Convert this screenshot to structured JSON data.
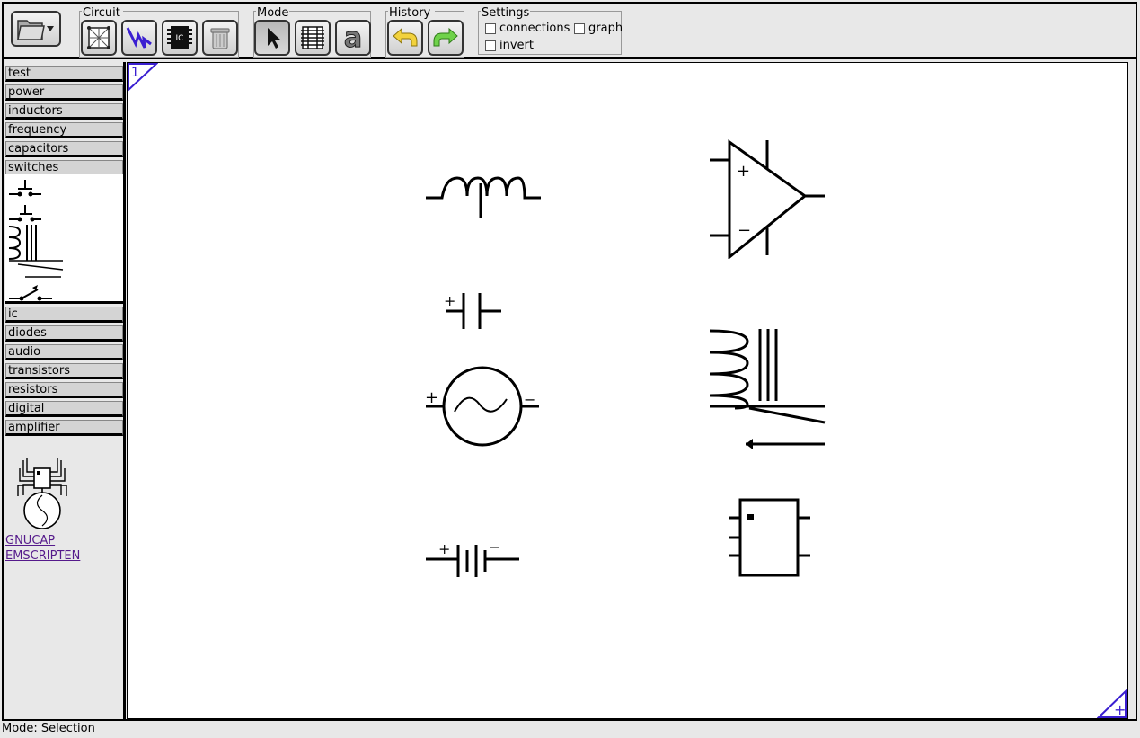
{
  "toolbar": {
    "groups": {
      "circuit": "Circuit",
      "mode": "Mode",
      "history": "History",
      "settings": "Settings"
    },
    "settings": {
      "connections": "connections",
      "graph": "graph",
      "invert": "invert"
    }
  },
  "sidebar": {
    "categories_top": [
      "test",
      "power",
      "inductors",
      "frequency",
      "capacitors"
    ],
    "open_category": "switches",
    "categories_bottom": [
      "ic",
      "diodes",
      "audio",
      "transistors",
      "resistors",
      "digital",
      "amplifier"
    ],
    "links": [
      "GNUCAP",
      "EMSCRIPTEN"
    ]
  },
  "canvas": {
    "page_number": "1",
    "add_page_symbol": "+",
    "symbols": [
      "inductor",
      "op-amp",
      "polarized-capacitor",
      "ac-voltage-source",
      "relay",
      "battery",
      "ic-chip"
    ]
  },
  "status": {
    "mode_text": "Mode: Selection"
  },
  "colors": {
    "accent": "#3a1fd1",
    "sidebar_bg": "#e8e8e8",
    "category_bg": "#d4d4d4"
  }
}
